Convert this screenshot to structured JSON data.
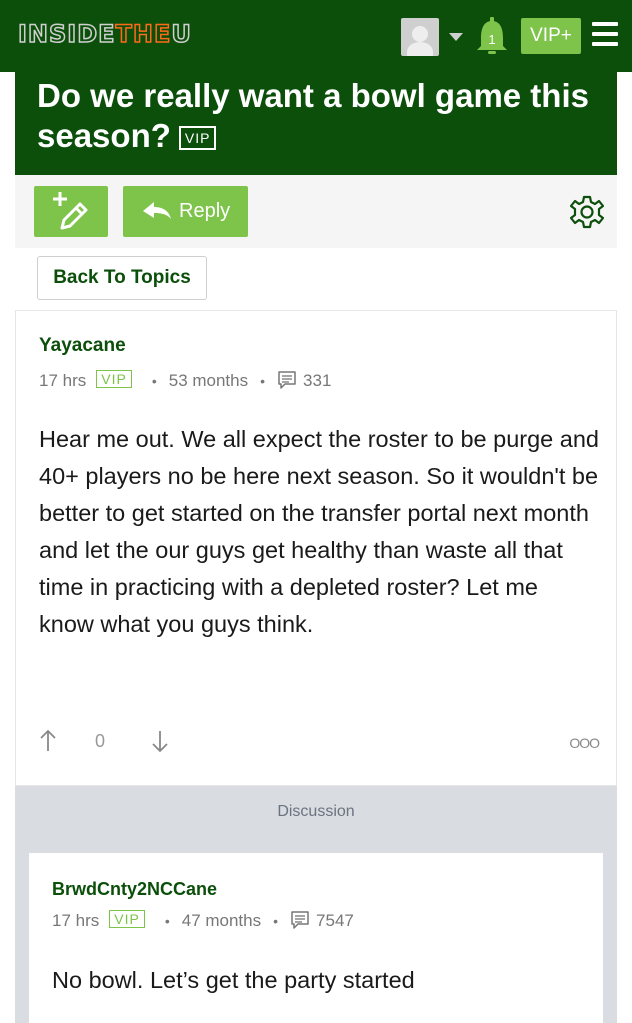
{
  "header": {
    "logo_part1": "INSIDE",
    "logo_part2": "THE",
    "logo_part3": "U",
    "notification_count": "1",
    "vip_button": "VIP+",
    "icons": [
      "avatar",
      "caret-down-icon",
      "bell-icon",
      "menu-icon"
    ]
  },
  "topic": {
    "title": "Do we really want a bowl game this season?",
    "title_tag": "VIP"
  },
  "actions": {
    "reply_label": "Reply",
    "back_label": "Back To Topics",
    "icons": [
      "new-post-icon",
      "reply-arrow-icon",
      "gear-icon"
    ]
  },
  "post": {
    "author": "Yayacane",
    "time": "17 hrs",
    "tag": "VIP",
    "tenure": "53 months",
    "post_count": "331",
    "body": "Hear me out. We all expect the roster to be purge and 40+ players no be here next season. So it wouldn't be better to get started on the transfer portal next month and let the our guys get healthy than waste all that time in practicing with a depleted roster? Let me know what you guys think.",
    "votes": "0",
    "more": "OOO"
  },
  "discussion_label": "Discussion",
  "reply": {
    "author": "BrwdCnty2NCCane",
    "time": "17 hrs",
    "tag": "VIP",
    "tenure": "47 months",
    "post_count": "7547",
    "body": "No bowl. Let’s get the party started"
  },
  "colors": {
    "brand_green": "#0b4f0b",
    "accent_green": "#7ec34a",
    "logo_orange": "#ff6a1a",
    "discussion_bg": "#d9dde1"
  }
}
